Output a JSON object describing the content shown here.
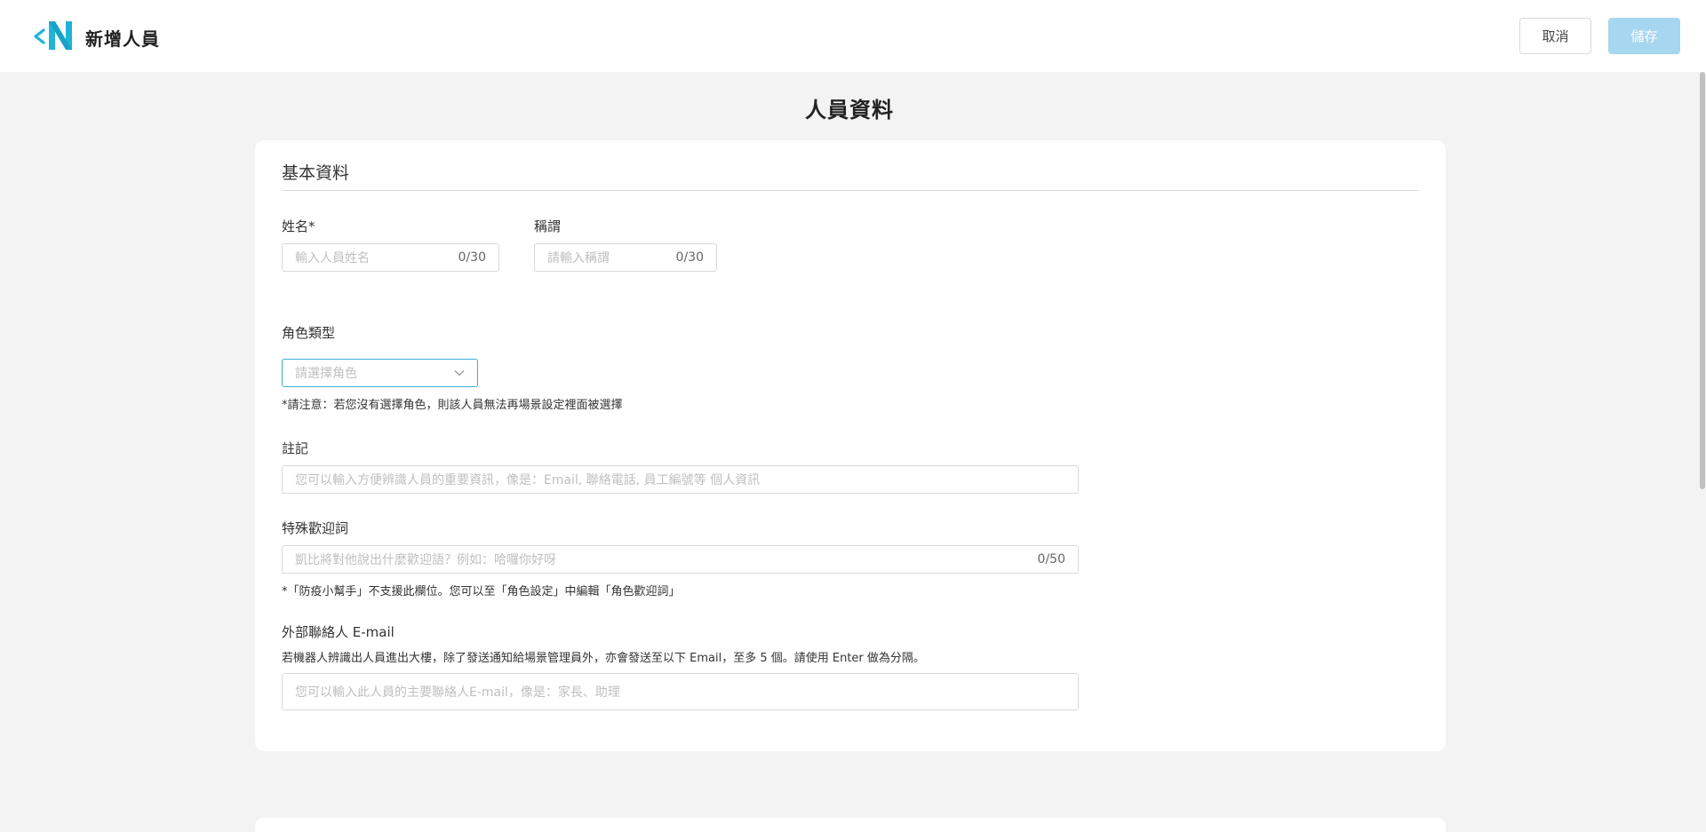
{
  "header": {
    "title": "新增人員",
    "cancel_label": "取消",
    "save_label": "儲存",
    "back_icon": "chevron-left-icon",
    "logo_icon": "n-logo-icon",
    "brand_color": "#1fb4d8"
  },
  "main": {
    "section_title": "人員資料"
  },
  "basic_info": {
    "heading": "基本資料",
    "name": {
      "label": "姓名*",
      "placeholder": "輸入人員姓名",
      "counter": "0/30"
    },
    "honorific": {
      "label": "稱謂",
      "placeholder": "請輸入稱謂",
      "counter": "0/30"
    },
    "role_type": {
      "label": "角色類型",
      "placeholder": "請選擇角色",
      "note": "*請注意：若您沒有選擇角色，則該人員無法再場景設定裡面被選擇"
    },
    "remark": {
      "label": "註記",
      "placeholder": "您可以輸入方便辨識人員的重要資訊，像是：Email, 聯絡電話, 員工編號等 個人資訊"
    },
    "greeting": {
      "label": "特殊歡迎詞",
      "placeholder": "凱比將對他說出什麼歡迎語？例如：哈囉你好呀",
      "counter": "0/50",
      "note": "*「防疫小幫手」不支援此欄位。您可以至「角色設定」中編輯「角色歡迎詞」"
    },
    "external_email": {
      "label": "外部聯絡人 E-mail",
      "description": "若機器人辨識出人員進出大樓，除了發送通知給場景管理員外，亦會發送至以下 Email，至多 5 個。請使用 Enter 做為分隔。",
      "placeholder": "您可以輸入此人員的主要聯絡人E-mail，像是：家長、助理"
    }
  }
}
